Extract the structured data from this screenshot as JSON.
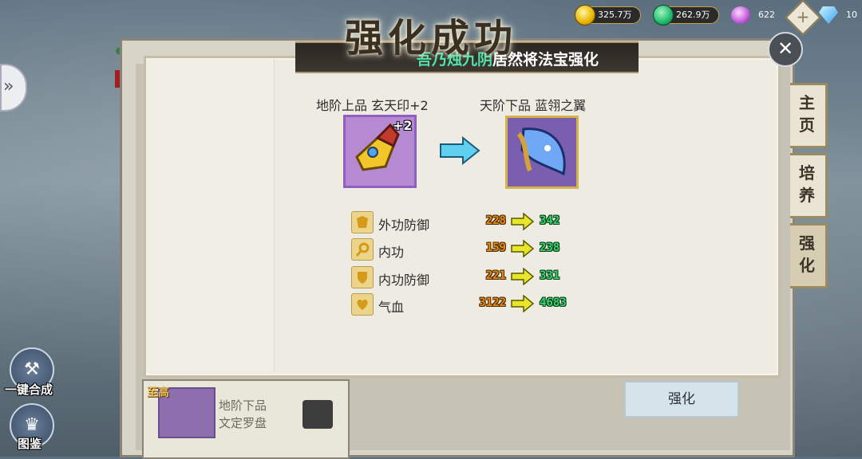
{
  "resources": {
    "gold": "325.7万",
    "jade": "262.9万",
    "ball": "622",
    "diamond": "10"
  },
  "title": "强化成功",
  "banner": {
    "name": "吾乃烛九阴",
    "message": "居然将法宝强化"
  },
  "item_from": {
    "name": "地阶上品 玄天印+2",
    "level_badge": "+2"
  },
  "item_to": {
    "name": "天阶下品 蓝翎之翼"
  },
  "stats": [
    {
      "label": "外功防御",
      "old": "228",
      "new": "342",
      "icon": "armor-icon"
    },
    {
      "label": "内功",
      "old": "159",
      "new": "238",
      "icon": "magic-icon"
    },
    {
      "label": "内功防御",
      "old": "221",
      "new": "331",
      "icon": "shield-icon"
    },
    {
      "label": "气血",
      "old": "3122",
      "new": "4683",
      "icon": "heart-icon"
    }
  ],
  "right_tabs": [
    "主页",
    "培养",
    "强化"
  ],
  "left_buttons": {
    "merge": "一键合成",
    "codex": "图鉴"
  },
  "background_item": {
    "tag": "至高",
    "line1": "地阶下品",
    "line2": "文定罗盘"
  },
  "strengthen_button": "强化",
  "colors": {
    "old_value": "#e88b12",
    "new_value": "#34d56a",
    "highlight_name": "#4fe3a8"
  }
}
